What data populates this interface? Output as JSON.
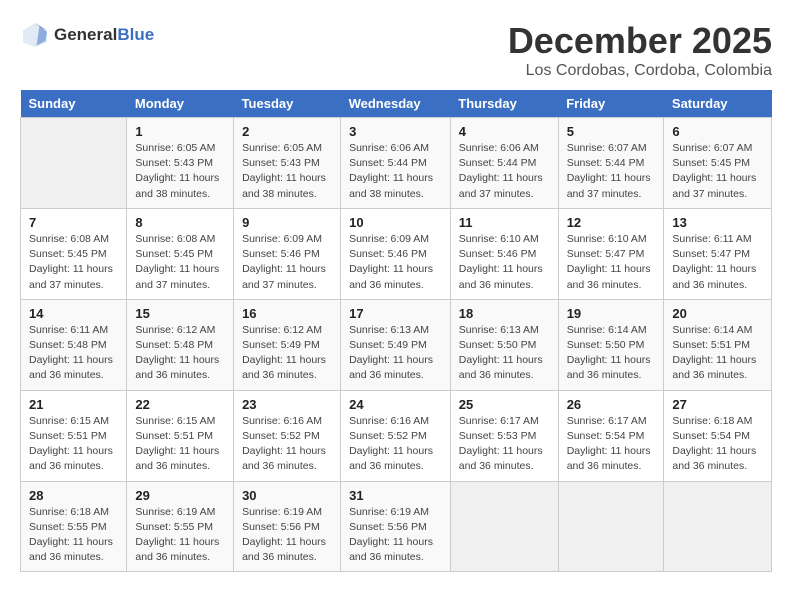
{
  "logo": {
    "general": "General",
    "blue": "Blue"
  },
  "title": "December 2025",
  "subtitle": "Los Cordobas, Cordoba, Colombia",
  "weekdays": [
    "Sunday",
    "Monday",
    "Tuesday",
    "Wednesday",
    "Thursday",
    "Friday",
    "Saturday"
  ],
  "weeks": [
    [
      {
        "day": "",
        "sunrise": "",
        "sunset": "",
        "daylight": ""
      },
      {
        "day": "1",
        "sunrise": "Sunrise: 6:05 AM",
        "sunset": "Sunset: 5:43 PM",
        "daylight": "Daylight: 11 hours and 38 minutes."
      },
      {
        "day": "2",
        "sunrise": "Sunrise: 6:05 AM",
        "sunset": "Sunset: 5:43 PM",
        "daylight": "Daylight: 11 hours and 38 minutes."
      },
      {
        "day": "3",
        "sunrise": "Sunrise: 6:06 AM",
        "sunset": "Sunset: 5:44 PM",
        "daylight": "Daylight: 11 hours and 38 minutes."
      },
      {
        "day": "4",
        "sunrise": "Sunrise: 6:06 AM",
        "sunset": "Sunset: 5:44 PM",
        "daylight": "Daylight: 11 hours and 37 minutes."
      },
      {
        "day": "5",
        "sunrise": "Sunrise: 6:07 AM",
        "sunset": "Sunset: 5:44 PM",
        "daylight": "Daylight: 11 hours and 37 minutes."
      },
      {
        "day": "6",
        "sunrise": "Sunrise: 6:07 AM",
        "sunset": "Sunset: 5:45 PM",
        "daylight": "Daylight: 11 hours and 37 minutes."
      }
    ],
    [
      {
        "day": "7",
        "sunrise": "Sunrise: 6:08 AM",
        "sunset": "Sunset: 5:45 PM",
        "daylight": "Daylight: 11 hours and 37 minutes."
      },
      {
        "day": "8",
        "sunrise": "Sunrise: 6:08 AM",
        "sunset": "Sunset: 5:45 PM",
        "daylight": "Daylight: 11 hours and 37 minutes."
      },
      {
        "day": "9",
        "sunrise": "Sunrise: 6:09 AM",
        "sunset": "Sunset: 5:46 PM",
        "daylight": "Daylight: 11 hours and 37 minutes."
      },
      {
        "day": "10",
        "sunrise": "Sunrise: 6:09 AM",
        "sunset": "Sunset: 5:46 PM",
        "daylight": "Daylight: 11 hours and 36 minutes."
      },
      {
        "day": "11",
        "sunrise": "Sunrise: 6:10 AM",
        "sunset": "Sunset: 5:46 PM",
        "daylight": "Daylight: 11 hours and 36 minutes."
      },
      {
        "day": "12",
        "sunrise": "Sunrise: 6:10 AM",
        "sunset": "Sunset: 5:47 PM",
        "daylight": "Daylight: 11 hours and 36 minutes."
      },
      {
        "day": "13",
        "sunrise": "Sunrise: 6:11 AM",
        "sunset": "Sunset: 5:47 PM",
        "daylight": "Daylight: 11 hours and 36 minutes."
      }
    ],
    [
      {
        "day": "14",
        "sunrise": "Sunrise: 6:11 AM",
        "sunset": "Sunset: 5:48 PM",
        "daylight": "Daylight: 11 hours and 36 minutes."
      },
      {
        "day": "15",
        "sunrise": "Sunrise: 6:12 AM",
        "sunset": "Sunset: 5:48 PM",
        "daylight": "Daylight: 11 hours and 36 minutes."
      },
      {
        "day": "16",
        "sunrise": "Sunrise: 6:12 AM",
        "sunset": "Sunset: 5:49 PM",
        "daylight": "Daylight: 11 hours and 36 minutes."
      },
      {
        "day": "17",
        "sunrise": "Sunrise: 6:13 AM",
        "sunset": "Sunset: 5:49 PM",
        "daylight": "Daylight: 11 hours and 36 minutes."
      },
      {
        "day": "18",
        "sunrise": "Sunrise: 6:13 AM",
        "sunset": "Sunset: 5:50 PM",
        "daylight": "Daylight: 11 hours and 36 minutes."
      },
      {
        "day": "19",
        "sunrise": "Sunrise: 6:14 AM",
        "sunset": "Sunset: 5:50 PM",
        "daylight": "Daylight: 11 hours and 36 minutes."
      },
      {
        "day": "20",
        "sunrise": "Sunrise: 6:14 AM",
        "sunset": "Sunset: 5:51 PM",
        "daylight": "Daylight: 11 hours and 36 minutes."
      }
    ],
    [
      {
        "day": "21",
        "sunrise": "Sunrise: 6:15 AM",
        "sunset": "Sunset: 5:51 PM",
        "daylight": "Daylight: 11 hours and 36 minutes."
      },
      {
        "day": "22",
        "sunrise": "Sunrise: 6:15 AM",
        "sunset": "Sunset: 5:51 PM",
        "daylight": "Daylight: 11 hours and 36 minutes."
      },
      {
        "day": "23",
        "sunrise": "Sunrise: 6:16 AM",
        "sunset": "Sunset: 5:52 PM",
        "daylight": "Daylight: 11 hours and 36 minutes."
      },
      {
        "day": "24",
        "sunrise": "Sunrise: 6:16 AM",
        "sunset": "Sunset: 5:52 PM",
        "daylight": "Daylight: 11 hours and 36 minutes."
      },
      {
        "day": "25",
        "sunrise": "Sunrise: 6:17 AM",
        "sunset": "Sunset: 5:53 PM",
        "daylight": "Daylight: 11 hours and 36 minutes."
      },
      {
        "day": "26",
        "sunrise": "Sunrise: 6:17 AM",
        "sunset": "Sunset: 5:54 PM",
        "daylight": "Daylight: 11 hours and 36 minutes."
      },
      {
        "day": "27",
        "sunrise": "Sunrise: 6:18 AM",
        "sunset": "Sunset: 5:54 PM",
        "daylight": "Daylight: 11 hours and 36 minutes."
      }
    ],
    [
      {
        "day": "28",
        "sunrise": "Sunrise: 6:18 AM",
        "sunset": "Sunset: 5:55 PM",
        "daylight": "Daylight: 11 hours and 36 minutes."
      },
      {
        "day": "29",
        "sunrise": "Sunrise: 6:19 AM",
        "sunset": "Sunset: 5:55 PM",
        "daylight": "Daylight: 11 hours and 36 minutes."
      },
      {
        "day": "30",
        "sunrise": "Sunrise: 6:19 AM",
        "sunset": "Sunset: 5:56 PM",
        "daylight": "Daylight: 11 hours and 36 minutes."
      },
      {
        "day": "31",
        "sunrise": "Sunrise: 6:19 AM",
        "sunset": "Sunset: 5:56 PM",
        "daylight": "Daylight: 11 hours and 36 minutes."
      },
      {
        "day": "",
        "sunrise": "",
        "sunset": "",
        "daylight": ""
      },
      {
        "day": "",
        "sunrise": "",
        "sunset": "",
        "daylight": ""
      },
      {
        "day": "",
        "sunrise": "",
        "sunset": "",
        "daylight": ""
      }
    ]
  ]
}
